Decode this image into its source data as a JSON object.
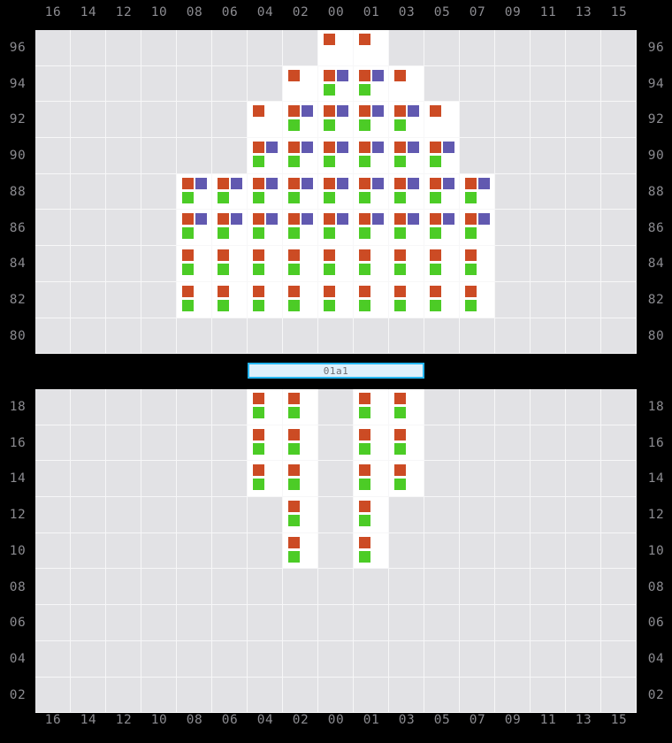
{
  "colors": {
    "red": "#CC4B24",
    "blue": "#6159B0",
    "green": "#4CCC26",
    "cell_empty": "#E2E2E5",
    "cell_filled": "#FFFFFF",
    "background": "#000000",
    "label_text": "#8B8B90",
    "midbar_fill": "#DFF0FB",
    "midbar_border": "#25B5F0"
  },
  "mid_bar": {
    "label": "01a1"
  },
  "columns": [
    "16",
    "14",
    "12",
    "10",
    "08",
    "06",
    "04",
    "02",
    "00",
    "01",
    "03",
    "05",
    "07",
    "09",
    "11",
    "13",
    "15"
  ],
  "top_panel": {
    "rows": [
      "96",
      "94",
      "92",
      "90",
      "88",
      "86",
      "84",
      "82",
      "80"
    ],
    "markers": {
      "96": {
        "00": [
          "red"
        ],
        "01": [
          "red"
        ]
      },
      "94": {
        "02": [
          "red"
        ],
        "00": [
          "red",
          "blue",
          "green"
        ],
        "01": [
          "red",
          "blue",
          "green"
        ],
        "03": [
          "red"
        ]
      },
      "92": {
        "04": [
          "red"
        ],
        "02": [
          "red",
          "blue",
          "green"
        ],
        "00": [
          "red",
          "blue",
          "green"
        ],
        "01": [
          "red",
          "blue",
          "green"
        ],
        "03": [
          "red",
          "blue",
          "green"
        ],
        "05": [
          "red"
        ]
      },
      "90": {
        "04": [
          "red",
          "blue",
          "green"
        ],
        "02": [
          "red",
          "blue",
          "green"
        ],
        "00": [
          "red",
          "blue",
          "green"
        ],
        "01": [
          "red",
          "blue",
          "green"
        ],
        "03": [
          "red",
          "blue",
          "green"
        ],
        "05": [
          "red",
          "blue",
          "green"
        ]
      },
      "88": {
        "08": [
          "red",
          "blue",
          "green"
        ],
        "06": [
          "red",
          "blue",
          "green"
        ],
        "04": [
          "red",
          "blue",
          "green"
        ],
        "02": [
          "red",
          "blue",
          "green"
        ],
        "00": [
          "red",
          "blue",
          "green"
        ],
        "01": [
          "red",
          "blue",
          "green"
        ],
        "03": [
          "red",
          "blue",
          "green"
        ],
        "05": [
          "red",
          "blue",
          "green"
        ],
        "07": [
          "red",
          "blue",
          "green"
        ]
      },
      "86": {
        "08": [
          "red",
          "blue",
          "green"
        ],
        "06": [
          "red",
          "blue",
          "green"
        ],
        "04": [
          "red",
          "blue",
          "green"
        ],
        "02": [
          "red",
          "blue",
          "green"
        ],
        "00": [
          "red",
          "blue",
          "green"
        ],
        "01": [
          "red",
          "blue",
          "green"
        ],
        "03": [
          "red",
          "blue",
          "green"
        ],
        "05": [
          "red",
          "blue",
          "green"
        ],
        "07": [
          "red",
          "blue",
          "green"
        ]
      },
      "84": {
        "08": [
          "red",
          "green"
        ],
        "06": [
          "red",
          "green"
        ],
        "04": [
          "red",
          "green"
        ],
        "02": [
          "red",
          "green"
        ],
        "00": [
          "red",
          "green"
        ],
        "01": [
          "red",
          "green"
        ],
        "03": [
          "red",
          "green"
        ],
        "05": [
          "red",
          "green"
        ],
        "07": [
          "red",
          "green"
        ]
      },
      "82": {
        "08": [
          "red",
          "green"
        ],
        "06": [
          "red",
          "green"
        ],
        "04": [
          "red",
          "green"
        ],
        "02": [
          "red",
          "green"
        ],
        "00": [
          "red",
          "green"
        ],
        "01": [
          "red",
          "green"
        ],
        "03": [
          "red",
          "green"
        ],
        "05": [
          "red",
          "green"
        ],
        "07": [
          "red",
          "green"
        ]
      },
      "80": {}
    }
  },
  "bottom_panel": {
    "rows": [
      "18",
      "16",
      "14",
      "12",
      "10",
      "08",
      "06",
      "04",
      "02"
    ],
    "markers": {
      "18": {
        "04": [
          "red",
          "green"
        ],
        "02": [
          "red",
          "green"
        ],
        "01": [
          "red",
          "green"
        ],
        "03": [
          "red",
          "green"
        ]
      },
      "16": {
        "04": [
          "red",
          "green"
        ],
        "02": [
          "red",
          "green"
        ],
        "01": [
          "red",
          "green"
        ],
        "03": [
          "red",
          "green"
        ]
      },
      "14": {
        "04": [
          "red",
          "green"
        ],
        "02": [
          "red",
          "green"
        ],
        "01": [
          "red",
          "green"
        ],
        "03": [
          "red",
          "green"
        ]
      },
      "12": {
        "02": [
          "red",
          "green"
        ],
        "01": [
          "red",
          "green"
        ]
      },
      "10": {
        "02": [
          "red",
          "green"
        ],
        "01": [
          "red",
          "green"
        ]
      },
      "08": {},
      "06": {},
      "04": {},
      "02": {}
    }
  },
  "chart_data": {
    "type": "heatmap",
    "title": "",
    "xlabel": "",
    "ylabel": "",
    "legend": [
      "red",
      "blue",
      "green"
    ],
    "grid": true,
    "panels": [
      {
        "name": "top",
        "x": [
          "16",
          "14",
          "12",
          "10",
          "08",
          "06",
          "04",
          "02",
          "00",
          "01",
          "03",
          "05",
          "07",
          "09",
          "11",
          "13",
          "15"
        ],
        "y": [
          "96",
          "94",
          "92",
          "90",
          "88",
          "86",
          "84",
          "82",
          "80"
        ],
        "cells": [
          {
            "x": "00",
            "y": "96",
            "v": [
              "red"
            ]
          },
          {
            "x": "01",
            "y": "96",
            "v": [
              "red"
            ]
          },
          {
            "x": "02",
            "y": "94",
            "v": [
              "red"
            ]
          },
          {
            "x": "00",
            "y": "94",
            "v": [
              "red",
              "blue",
              "green"
            ]
          },
          {
            "x": "01",
            "y": "94",
            "v": [
              "red",
              "blue",
              "green"
            ]
          },
          {
            "x": "03",
            "y": "94",
            "v": [
              "red"
            ]
          },
          {
            "x": "04",
            "y": "92",
            "v": [
              "red"
            ]
          },
          {
            "x": "02",
            "y": "92",
            "v": [
              "red",
              "blue",
              "green"
            ]
          },
          {
            "x": "00",
            "y": "92",
            "v": [
              "red",
              "blue",
              "green"
            ]
          },
          {
            "x": "01",
            "y": "92",
            "v": [
              "red",
              "blue",
              "green"
            ]
          },
          {
            "x": "03",
            "y": "92",
            "v": [
              "red",
              "blue",
              "green"
            ]
          },
          {
            "x": "05",
            "y": "92",
            "v": [
              "red"
            ]
          },
          {
            "x": "04",
            "y": "90",
            "v": [
              "red",
              "blue",
              "green"
            ]
          },
          {
            "x": "02",
            "y": "90",
            "v": [
              "red",
              "blue",
              "green"
            ]
          },
          {
            "x": "00",
            "y": "90",
            "v": [
              "red",
              "blue",
              "green"
            ]
          },
          {
            "x": "01",
            "y": "90",
            "v": [
              "red",
              "blue",
              "green"
            ]
          },
          {
            "x": "03",
            "y": "90",
            "v": [
              "red",
              "blue",
              "green"
            ]
          },
          {
            "x": "05",
            "y": "90",
            "v": [
              "red",
              "blue",
              "green"
            ]
          },
          {
            "x": "08",
            "y": "88",
            "v": [
              "red",
              "blue",
              "green"
            ]
          },
          {
            "x": "06",
            "y": "88",
            "v": [
              "red",
              "blue",
              "green"
            ]
          },
          {
            "x": "04",
            "y": "88",
            "v": [
              "red",
              "blue",
              "green"
            ]
          },
          {
            "x": "02",
            "y": "88",
            "v": [
              "red",
              "blue",
              "green"
            ]
          },
          {
            "x": "00",
            "y": "88",
            "v": [
              "red",
              "blue",
              "green"
            ]
          },
          {
            "x": "01",
            "y": "88",
            "v": [
              "red",
              "blue",
              "green"
            ]
          },
          {
            "x": "03",
            "y": "88",
            "v": [
              "red",
              "blue",
              "green"
            ]
          },
          {
            "x": "05",
            "y": "88",
            "v": [
              "red",
              "blue",
              "green"
            ]
          },
          {
            "x": "07",
            "y": "88",
            "v": [
              "red",
              "blue",
              "green"
            ]
          },
          {
            "x": "08",
            "y": "86",
            "v": [
              "red",
              "blue",
              "green"
            ]
          },
          {
            "x": "06",
            "y": "86",
            "v": [
              "red",
              "blue",
              "green"
            ]
          },
          {
            "x": "04",
            "y": "86",
            "v": [
              "red",
              "blue",
              "green"
            ]
          },
          {
            "x": "02",
            "y": "86",
            "v": [
              "red",
              "blue",
              "green"
            ]
          },
          {
            "x": "00",
            "y": "86",
            "v": [
              "red",
              "blue",
              "green"
            ]
          },
          {
            "x": "01",
            "y": "86",
            "v": [
              "red",
              "blue",
              "green"
            ]
          },
          {
            "x": "03",
            "y": "86",
            "v": [
              "red",
              "blue",
              "green"
            ]
          },
          {
            "x": "05",
            "y": "86",
            "v": [
              "red",
              "blue",
              "green"
            ]
          },
          {
            "x": "07",
            "y": "86",
            "v": [
              "red",
              "blue",
              "green"
            ]
          },
          {
            "x": "08",
            "y": "84",
            "v": [
              "red",
              "green"
            ]
          },
          {
            "x": "06",
            "y": "84",
            "v": [
              "red",
              "green"
            ]
          },
          {
            "x": "04",
            "y": "84",
            "v": [
              "red",
              "green"
            ]
          },
          {
            "x": "02",
            "y": "84",
            "v": [
              "red",
              "green"
            ]
          },
          {
            "x": "00",
            "y": "84",
            "v": [
              "red",
              "green"
            ]
          },
          {
            "x": "01",
            "y": "84",
            "v": [
              "red",
              "green"
            ]
          },
          {
            "x": "03",
            "y": "84",
            "v": [
              "red",
              "green"
            ]
          },
          {
            "x": "05",
            "y": "84",
            "v": [
              "red",
              "green"
            ]
          },
          {
            "x": "07",
            "y": "84",
            "v": [
              "red",
              "green"
            ]
          },
          {
            "x": "08",
            "y": "82",
            "v": [
              "red",
              "green"
            ]
          },
          {
            "x": "06",
            "y": "82",
            "v": [
              "red",
              "green"
            ]
          },
          {
            "x": "04",
            "y": "82",
            "v": [
              "red",
              "green"
            ]
          },
          {
            "x": "02",
            "y": "82",
            "v": [
              "red",
              "green"
            ]
          },
          {
            "x": "00",
            "y": "82",
            "v": [
              "red",
              "green"
            ]
          },
          {
            "x": "01",
            "y": "82",
            "v": [
              "red",
              "green"
            ]
          },
          {
            "x": "03",
            "y": "82",
            "v": [
              "red",
              "green"
            ]
          },
          {
            "x": "05",
            "y": "82",
            "v": [
              "red",
              "green"
            ]
          },
          {
            "x": "07",
            "y": "82",
            "v": [
              "red",
              "green"
            ]
          }
        ]
      },
      {
        "name": "bottom",
        "x": [
          "16",
          "14",
          "12",
          "10",
          "08",
          "06",
          "04",
          "02",
          "00",
          "01",
          "03",
          "05",
          "07",
          "09",
          "11",
          "13",
          "15"
        ],
        "y": [
          "18",
          "16",
          "14",
          "12",
          "10",
          "08",
          "06",
          "04",
          "02"
        ],
        "cells": [
          {
            "x": "04",
            "y": "18",
            "v": [
              "red",
              "green"
            ]
          },
          {
            "x": "02",
            "y": "18",
            "v": [
              "red",
              "green"
            ]
          },
          {
            "x": "01",
            "y": "18",
            "v": [
              "red",
              "green"
            ]
          },
          {
            "x": "03",
            "y": "18",
            "v": [
              "red",
              "green"
            ]
          },
          {
            "x": "04",
            "y": "16",
            "v": [
              "red",
              "green"
            ]
          },
          {
            "x": "02",
            "y": "16",
            "v": [
              "red",
              "green"
            ]
          },
          {
            "x": "01",
            "y": "16",
            "v": [
              "red",
              "green"
            ]
          },
          {
            "x": "03",
            "y": "16",
            "v": [
              "red",
              "green"
            ]
          },
          {
            "x": "04",
            "y": "14",
            "v": [
              "red",
              "green"
            ]
          },
          {
            "x": "02",
            "y": "14",
            "v": [
              "red",
              "green"
            ]
          },
          {
            "x": "01",
            "y": "14",
            "v": [
              "red",
              "green"
            ]
          },
          {
            "x": "03",
            "y": "14",
            "v": [
              "red",
              "green"
            ]
          },
          {
            "x": "02",
            "y": "12",
            "v": [
              "red",
              "green"
            ]
          },
          {
            "x": "01",
            "y": "12",
            "v": [
              "red",
              "green"
            ]
          },
          {
            "x": "02",
            "y": "10",
            "v": [
              "red",
              "green"
            ]
          },
          {
            "x": "01",
            "y": "10",
            "v": [
              "red",
              "green"
            ]
          }
        ]
      }
    ]
  }
}
